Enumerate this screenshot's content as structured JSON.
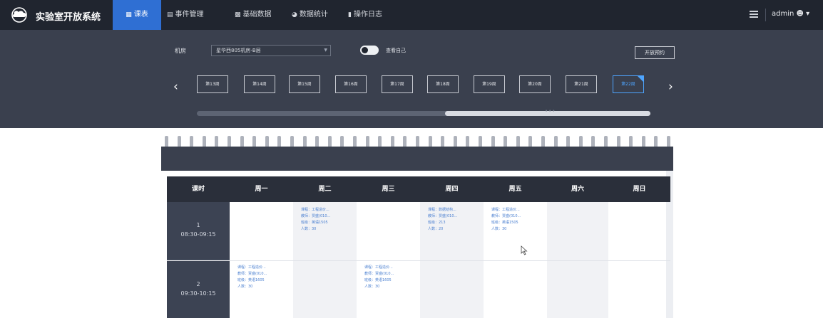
{
  "app": {
    "title": "实验室开放系统"
  },
  "nav": {
    "items": [
      {
        "icon": "calendar-icon",
        "label": "课表",
        "active": true
      },
      {
        "icon": "list-icon",
        "label": "事件管理",
        "active": false
      },
      {
        "icon": "bar-chart-icon",
        "label": "基础数据",
        "active": false
      },
      {
        "icon": "pie-chart-icon",
        "label": "数据统计",
        "active": false
      },
      {
        "icon": "document-icon",
        "label": "操作日志",
        "active": false
      }
    ]
  },
  "user": {
    "name": "admin"
  },
  "filters": {
    "room_label": "机房",
    "room_value": "星华西805机房-B层",
    "toggle_label": "查看自己",
    "toggle_on": false,
    "open_booking_label": "开放预约"
  },
  "weeks": {
    "items": [
      "第13周",
      "第14周",
      "第15周",
      "第16周",
      "第17周",
      "第18周",
      "第19周",
      "第20周",
      "第21周",
      "第22周"
    ],
    "active_index": 9,
    "scroll_position": 0.55
  },
  "timetable": {
    "headers": [
      "课时",
      "周一",
      "周二",
      "周三",
      "周四",
      "周五",
      "周六",
      "周日"
    ],
    "periods": [
      {
        "num": "1",
        "time": "08:30-09:15"
      },
      {
        "num": "2",
        "time": "09:30-10:15"
      }
    ],
    "entries": [
      {
        "course": "课程：工程造价...",
        "teacher": "教师：贾盛(010...",
        "class": "班级：英语1505",
        "count": "人数：30"
      },
      {
        "course": "课程：数据结构...",
        "teacher": "教师：贾盛(010...",
        "class": "班级：213",
        "count": "人数：20"
      },
      {
        "course": "课程：工程造价...",
        "teacher": "教师：贾盛(010...",
        "class": "班级：英语1505",
        "count": "人数：30"
      },
      {
        "course": "课程：工程造价...",
        "teacher": "教师：贾盛(010...",
        "class": "班级：英语1605",
        "count": "人数：30"
      },
      {
        "course": "课程：工程造价...",
        "teacher": "教师：贾盛(010...",
        "class": "班级：英语1605",
        "count": "人数：30"
      }
    ]
  },
  "colors": {
    "nav_active": "#2f6fd3",
    "week_active": "#4ea5ff",
    "entry_text": "#4a7fd0"
  }
}
